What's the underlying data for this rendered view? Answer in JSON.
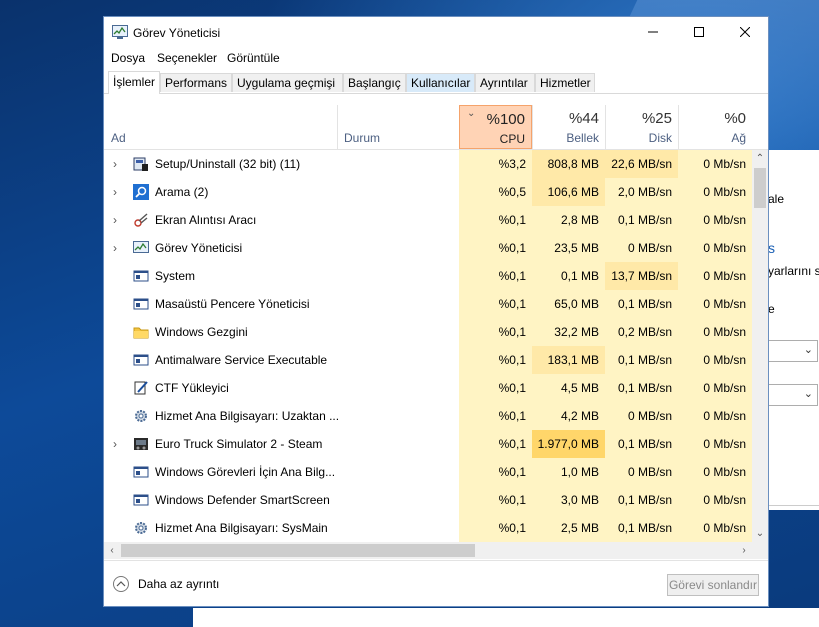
{
  "window": {
    "title": "Görev Yöneticisi"
  },
  "menu": [
    "Dosya",
    "Seçenekler",
    "Görüntüle"
  ],
  "tabs": [
    "İşlemler",
    "Performans",
    "Uygulama geçmişi",
    "Başlangıç",
    "Kullanıcılar",
    "Ayrıntılar",
    "Hizmetler"
  ],
  "active_tab": "İşlemler",
  "columns": {
    "name": "Ad",
    "status": "Durum",
    "cpu": {
      "pct": "%100",
      "label": "CPU"
    },
    "memory": {
      "pct": "%44",
      "label": "Bellek"
    },
    "disk": {
      "pct": "%25",
      "label": "Disk"
    },
    "network": {
      "pct": "%0",
      "label": "Ağ"
    }
  },
  "processes": [
    {
      "name": "Setup/Uninstall (32 bit) (11)",
      "icon": "setup-icon",
      "expandable": true,
      "cpu": "%3,2",
      "memory": "808,8 MB",
      "disk": "22,6 MB/sn",
      "network": "0 Mb/sn"
    },
    {
      "name": "Arama (2)",
      "icon": "search-icon",
      "expandable": true,
      "cpu": "%0,5",
      "memory": "106,6 MB",
      "disk": "2,0 MB/sn",
      "network": "0 Mb/sn"
    },
    {
      "name": "Ekran Alıntısı Aracı",
      "icon": "snipping-tool-icon",
      "expandable": true,
      "cpu": "%0,1",
      "memory": "2,8 MB",
      "disk": "0,1 MB/sn",
      "network": "0 Mb/sn"
    },
    {
      "name": "Görev Yöneticisi",
      "icon": "task-manager-icon",
      "expandable": true,
      "cpu": "%0,1",
      "memory": "23,5 MB",
      "disk": "0 MB/sn",
      "network": "0 Mb/sn"
    },
    {
      "name": "System",
      "icon": "system-icon",
      "expandable": false,
      "cpu": "%0,1",
      "memory": "0,1 MB",
      "disk": "13,7 MB/sn",
      "network": "0 Mb/sn"
    },
    {
      "name": "Masaüstü Pencere Yöneticisi",
      "icon": "window-manager-icon",
      "expandable": false,
      "cpu": "%0,1",
      "memory": "65,0 MB",
      "disk": "0,1 MB/sn",
      "network": "0 Mb/sn"
    },
    {
      "name": "Windows Gezgini",
      "icon": "folder-icon",
      "expandable": false,
      "cpu": "%0,1",
      "memory": "32,2 MB",
      "disk": "0,2 MB/sn",
      "network": "0 Mb/sn"
    },
    {
      "name": "Antimalware Service Executable",
      "icon": "service-icon",
      "expandable": false,
      "cpu": "%0,1",
      "memory": "183,1 MB",
      "disk": "0,1 MB/sn",
      "network": "0 Mb/sn"
    },
    {
      "name": "CTF Yükleyici",
      "icon": "ctf-loader-icon",
      "expandable": false,
      "cpu": "%0,1",
      "memory": "4,5 MB",
      "disk": "0,1 MB/sn",
      "network": "0 Mb/sn"
    },
    {
      "name": "Hizmet Ana Bilgisayarı: Uzaktan ...",
      "icon": "gear-icon",
      "expandable": false,
      "cpu": "%0,1",
      "memory": "4,2 MB",
      "disk": "0 MB/sn",
      "network": "0 Mb/sn"
    },
    {
      "name": "Euro Truck Simulator 2 - Steam",
      "icon": "truck-icon",
      "expandable": true,
      "cpu": "%0,1",
      "memory": "1.977,0 MB",
      "disk": "0,1 MB/sn",
      "network": "0 Mb/sn"
    },
    {
      "name": "Windows Görevleri İçin Ana Bilg...",
      "icon": "service-icon",
      "expandable": false,
      "cpu": "%0,1",
      "memory": "1,0 MB",
      "disk": "0 MB/sn",
      "network": "0 Mb/sn"
    },
    {
      "name": "Windows Defender SmartScreen",
      "icon": "service-icon",
      "expandable": false,
      "cpu": "%0,1",
      "memory": "3,0 MB",
      "disk": "0,1 MB/sn",
      "network": "0 Mb/sn"
    },
    {
      "name": "Hizmet Ana Bilgisayarı: SysMain",
      "icon": "gear-icon",
      "expandable": false,
      "cpu": "%0,1",
      "memory": "2,5 MB",
      "disk": "0,1 MB/sn",
      "network": "0 Mb/sn"
    }
  ],
  "footer": {
    "less_details": "Daha az ayrıntı",
    "end_task": "Görevi sonlandır"
  },
  "background_window": {
    "frag1": "ale",
    "frag2": "s",
    "frag3": "yarlarını s",
    "frag4": "e"
  },
  "colors": {
    "cpu_header": "#ffd3b5",
    "heat_low": "#fff4c4",
    "heat_mid": "#ffe9a8",
    "heat_high": "#ffd66a"
  }
}
